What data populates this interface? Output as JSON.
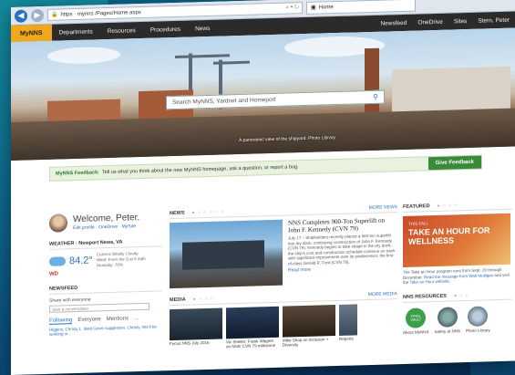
{
  "browser": {
    "address": "https://mynns.hii-nns.com/sites/mynns/",
    "address_short": "https · mynns /Pages/Home.aspx",
    "tab_label": "Home"
  },
  "topnav": {
    "brand": "MyNNS",
    "items": [
      "Departments",
      "Resources",
      "Procedures",
      "News"
    ],
    "right_items": [
      "Newsfeed",
      "OneDrive",
      "Sites",
      "Stern, Peter"
    ]
  },
  "hero": {
    "search_placeholder": "Search MyNNS, Yardnet and Homeport",
    "caption": "A panoramic view of the shipyard. Photo Library"
  },
  "feedback": {
    "label": "MyNNS Feedback:",
    "text": "Tell us what you think about the new MyNNS homepage, ask a question, or report a bug.",
    "button": "Give Feedback"
  },
  "welcome": {
    "greeting": "Welcome, Peter.",
    "links": "Edit profile · OneDrive · MySite"
  },
  "weather": {
    "title": "WEATHER · Newport News, VA",
    "temp": "84.2°",
    "desc_line1": "Current: Mostly Cloudy",
    "desc_line2": "Wind: From the S at 5 mph",
    "desc_line3": "Humidity: 70%",
    "provider": "WD"
  },
  "newsfeed": {
    "title": "NEWSFEED",
    "share": "Share with everyone",
    "placeholder": "Start a conversation",
    "tabs": [
      "Following",
      "Everyone",
      "Mentions",
      "..."
    ],
    "item": "Higgins, Christy L. liked Gown suggestion. Christy: We'll be working in..."
  },
  "news": {
    "title": "NEWS",
    "more": "MORE NEWS",
    "headline": "NNS Completes 900-Ton Superlift on John F. Kennedy (CVN 79)",
    "body": "July 17 – Shipbuilders recently placed a 900-ton superlift into dry dock, continuing construction of John F. Kennedy (CVN 79). Kennedy begins to take shape in the dry dock; the ship's cost and construction schedule continue on track with significant improvement over its predecessor, the first-of-class Gerald R. Ford (CVN 78).",
    "read_more": "Read more"
  },
  "media": {
    "title": "MEDIA",
    "more": "MORE MEDIA",
    "items": [
      "Focus NNS July 2016",
      "Vic Sheller: Frank Wagner on NNS' CVN 79 milestone",
      "Mike Shop on Inclusion + Diversity",
      "Reports"
    ]
  },
  "featured": {
    "title": "FEATURED",
    "small": "THIS FALL",
    "big": "TAKE AN HOUR FOR WELLNESS",
    "text_a": "The Take an Hour program runs from Sept. 20 through December. ",
    "link_a": "Read the message from Walt Mulligan",
    "text_b": " and visit the ",
    "link_b": "Take an Hour website",
    "text_c": "."
  },
  "resources": {
    "title": "NNS RESOURCES",
    "items": [
      {
        "label": "About MyNNS",
        "badge": "FINAL VAULT"
      },
      {
        "label": "Safety at NNS",
        "badge": ""
      },
      {
        "label": "Photo Library",
        "badge": ""
      }
    ]
  },
  "colors": {
    "brand": "#f0a81a",
    "accent": "#2a6fc0",
    "feedback_button": "#3a8a3a"
  }
}
